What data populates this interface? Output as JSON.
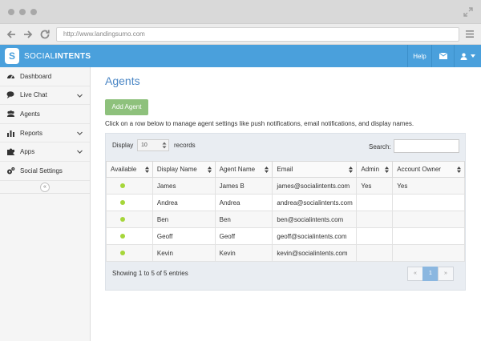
{
  "browser": {
    "url": "http://www.landingsumo.com"
  },
  "app": {
    "brand_light": "SOCIAL",
    "brand_bold": "INTENTS",
    "logo_glyph": "S",
    "accent_color": "#4aa0dc",
    "header_buttons": {
      "help_label": "Help",
      "mail_icon": "envelope-icon",
      "user_icon": "user-icon"
    }
  },
  "sidebar": {
    "items": [
      {
        "label": "Dashboard",
        "icon": "dashboard-icon",
        "has_chevron": false
      },
      {
        "label": "Live Chat",
        "icon": "chat-icon",
        "has_chevron": true
      },
      {
        "label": "Agents",
        "icon": "users-icon",
        "has_chevron": false
      },
      {
        "label": "Reports",
        "icon": "chart-icon",
        "has_chevron": true
      },
      {
        "label": "Apps",
        "icon": "puzzle-icon",
        "has_chevron": true
      },
      {
        "label": "Social Settings",
        "icon": "gears-icon",
        "has_chevron": false
      }
    ],
    "collapse_glyph": "«"
  },
  "main": {
    "title": "Agents",
    "add_button": "Add Agent",
    "hint": "Click on a row below to manage agent settings like push notifications, email notifications, and display names.",
    "table_controls": {
      "display_label": "Display",
      "display_value": "10",
      "records_label": "records",
      "search_label": "Search:"
    },
    "table": {
      "headers": [
        "Available",
        "Display Name",
        "Agent Name",
        "Email",
        "Admin",
        "Account Owner"
      ],
      "rows": [
        {
          "available": true,
          "display_name": "James",
          "agent_name": "James B",
          "email": "james@socialintents.com",
          "admin": "Yes",
          "owner": "Yes"
        },
        {
          "available": true,
          "display_name": "Andrea",
          "agent_name": "Andrea",
          "email": "andrea@socialintents.com",
          "admin": "",
          "owner": ""
        },
        {
          "available": true,
          "display_name": "Ben",
          "agent_name": "Ben",
          "email": "ben@socialintents.com",
          "admin": "",
          "owner": ""
        },
        {
          "available": true,
          "display_name": "Geoff",
          "agent_name": "Geoff",
          "email": "geoff@socialintents.com",
          "admin": "",
          "owner": ""
        },
        {
          "available": true,
          "display_name": "Kevin",
          "agent_name": "Kevin",
          "email": "kevin@socialintents.com",
          "admin": "",
          "owner": ""
        }
      ]
    },
    "info": "Showing 1 to 5 of 5 entries",
    "pager": {
      "prev": "«",
      "current": "1",
      "next": "»"
    }
  }
}
